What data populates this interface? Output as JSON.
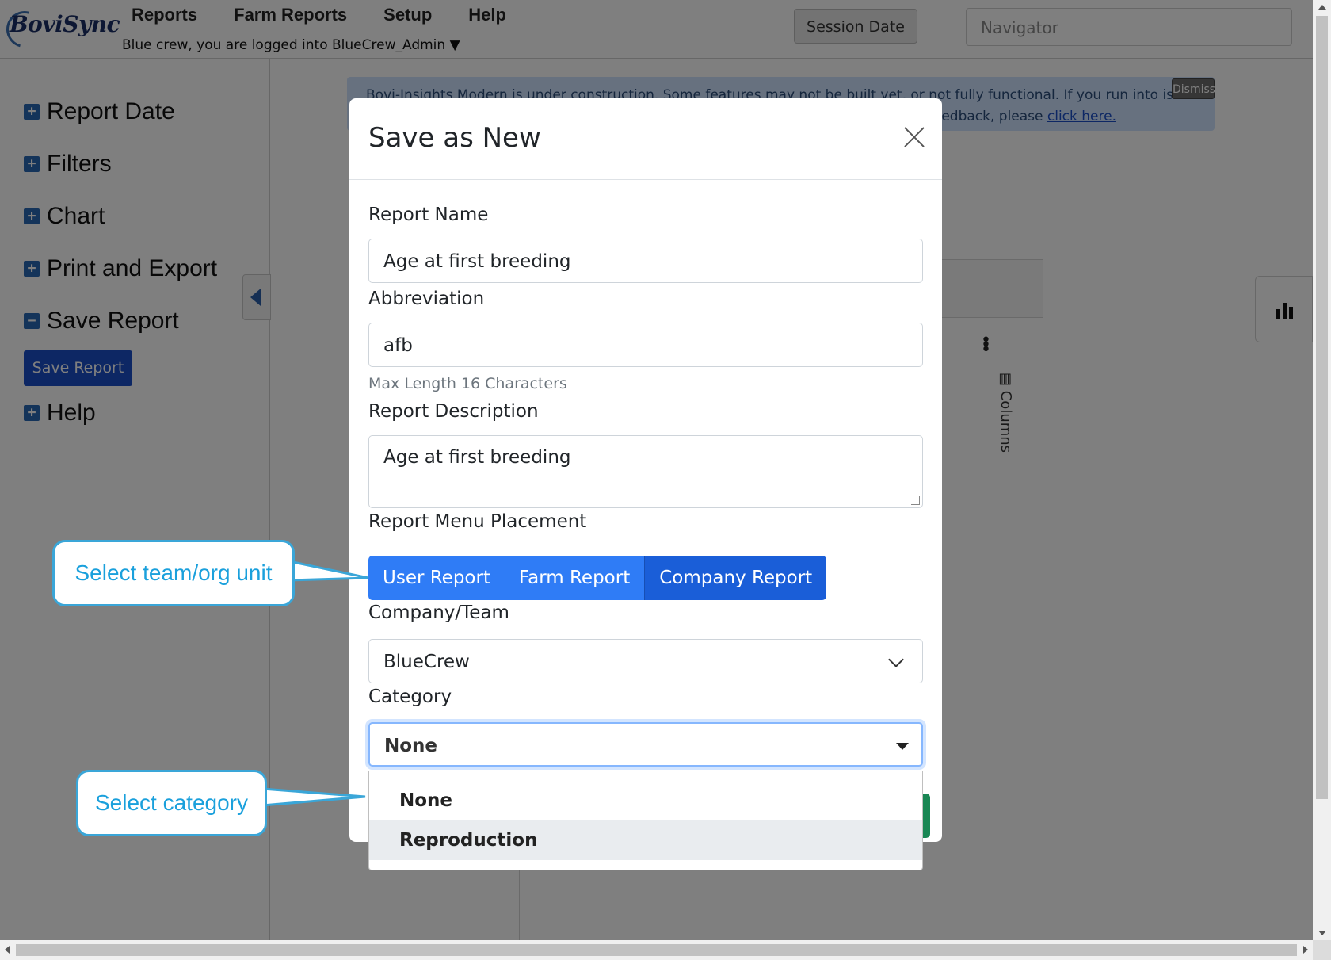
{
  "header": {
    "logo_text": "BoviSync",
    "menu": [
      "Reports",
      "Farm Reports",
      "Setup",
      "Help"
    ],
    "login_text": "Blue crew, you are logged into BlueCrew_Admin ▼",
    "session_button": "Session Date",
    "navigator_placeholder": "Navigator"
  },
  "sidebar": {
    "items": [
      {
        "label": "Report Date",
        "state": "+"
      },
      {
        "label": "Filters",
        "state": "+"
      },
      {
        "label": "Chart",
        "state": "+"
      },
      {
        "label": "Print and Export",
        "state": "+"
      },
      {
        "label": "Save Report",
        "state": "−"
      },
      {
        "label": "Help",
        "state": "+"
      }
    ],
    "save_button": "Save Report"
  },
  "banner": {
    "line1": "Bovi-Insights Modern is under construction. Some features may not be built yet, or not fully functional. If you run into issues,",
    "line2_prefix": "or feedback, please ",
    "link": "click here.",
    "dismiss": "Dismiss"
  },
  "grid": {
    "columns_tab": "Columns"
  },
  "modal": {
    "title": "Save as New",
    "report_name_label": "Report Name",
    "report_name_value": "Age at first breeding",
    "abbreviation_label": "Abbreviation",
    "abbreviation_value": "afb",
    "abbreviation_hint": "Max Length 16 Characters",
    "description_label": "Report Description",
    "description_value": "Age at first breeding",
    "placement_label": "Report Menu Placement",
    "placement_options": [
      "User Report",
      "Farm Report",
      "Company Report"
    ],
    "placement_selected": "Company Report",
    "company_label": "Company/Team",
    "company_value": "BlueCrew",
    "category_label": "Category",
    "category_value": "None",
    "category_options": [
      "None",
      "Reproduction"
    ],
    "category_hovered": "Reproduction"
  },
  "callouts": {
    "team": "Select team/org unit",
    "category": "Select category"
  },
  "colors": {
    "primary": "#2f7cf6",
    "primary_active": "#1a5ed8",
    "sidebar_button": "#1a4fc9",
    "callout_border": "#3aa6d8",
    "callout_text": "#1aa0dc",
    "success": "#198754"
  }
}
